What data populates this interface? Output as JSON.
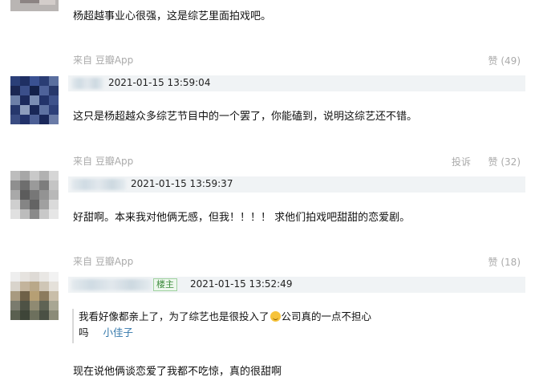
{
  "comments": [
    {
      "text": "杨超越事业心很强，这是综艺里面拍戏吧。",
      "source": "来自 豆瓣App",
      "vote_label": "赞 (49)"
    },
    {
      "timestamp": "2021-01-15 13:59:04",
      "text": "这只是杨超越众多综艺节目中的一个罢了，你能磕到，说明这综艺还不错。",
      "source": "来自 豆瓣App",
      "report_label": "投诉",
      "vote_label": "赞 (32)"
    },
    {
      "timestamp": "2021-01-15 13:59:37",
      "text": "好甜啊。本来我对他俩无感，但我！！！！ 求他们拍戏吧甜甜的恋爱剧。",
      "source": "来自 豆瓣App",
      "vote_label": "赞 (18)"
    },
    {
      "badge": "楼主",
      "timestamp": "2021-01-15 13:52:49",
      "quote_line1_a": "我看好像都亲上了，为了综艺也是很投入了",
      "quote_line1_b": "公司真的一点不担心",
      "quote_line2": "吗",
      "quote_user": "小佳子",
      "text": "现在说他俩谈恋爱了我都不吃惊，真的很甜啊"
    }
  ],
  "icons": {
    "emoji": "laughing-tears-emoji"
  },
  "colors": {
    "meta_gray": "#aaaaaa",
    "header_bg": "#f0f3f5",
    "link_blue": "#3377aa",
    "op_badge_green": "#3b8a3b"
  }
}
